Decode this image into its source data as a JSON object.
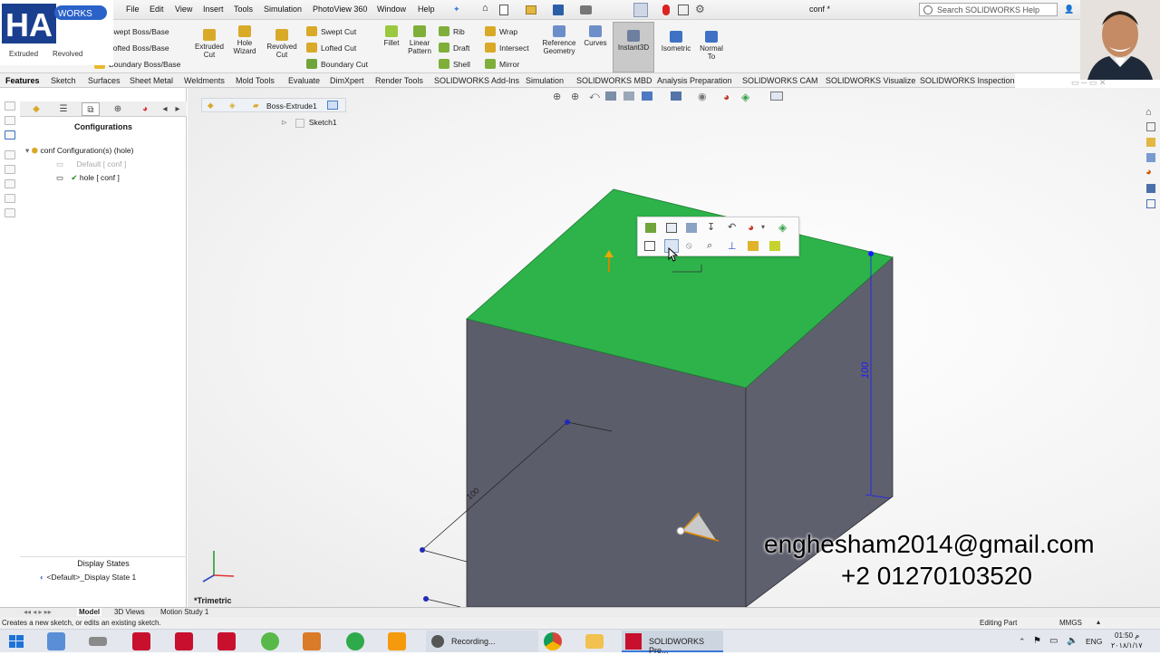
{
  "menu": {
    "items": [
      "File",
      "Edit",
      "View",
      "Insert",
      "Tools",
      "Simulation",
      "PhotoView 360",
      "Window",
      "Help"
    ],
    "doc_title": "conf *",
    "search_placeholder": "Search SOLIDWORKS Help"
  },
  "ribbon": {
    "extruded_boss": "Extruded Boss/Base",
    "revolved_boss": "Revolved Boss/Base",
    "swept_boss": "Swept Boss/Base",
    "lofted_boss": "Lofted Boss/Base",
    "boundary_boss": "Boundary Boss/Base",
    "extruded_cut": "Extruded Cut",
    "hole_wizard": "Hole Wizard",
    "revolved_cut": "Revolved Cut",
    "swept_cut": "Swept Cut",
    "lofted_cut": "Lofted Cut",
    "boundary_cut": "Boundary Cut",
    "fillet": "Fillet",
    "linear_pattern": "Linear Pattern",
    "rib": "Rib",
    "draft": "Draft",
    "shell": "Shell",
    "wrap": "Wrap",
    "intersect": "Intersect",
    "mirror": "Mirror",
    "reference_geometry": "Reference Geometry",
    "curves": "Curves",
    "instant3d": "Instant3D",
    "isometric": "Isometric",
    "normal_to": "Normal To"
  },
  "tabs": [
    "Features",
    "Sketch",
    "Surfaces",
    "Sheet Metal",
    "Weldments",
    "Mold Tools",
    "Evaluate",
    "DimXpert",
    "Render Tools",
    "SOLIDWORKS Add-Ins",
    "Simulation",
    "SOLIDWORKS MBD",
    "Analysis Preparation",
    "SOLIDWORKS CAM",
    "SOLIDWORKS Visualize",
    "SOLIDWORKS Inspection"
  ],
  "left_panel": {
    "title": "Configurations",
    "root": "conf Configuration(s)  (hole)",
    "items": [
      "Default [ conf ]",
      "hole [ conf ]"
    ],
    "display_states_title": "Display States",
    "display_state": "<Default>_Display State 1"
  },
  "breadcrumb": {
    "feature": "Boss-Extrude1",
    "sketch": "Sketch1"
  },
  "viewport": {
    "dimension_vertical": "100",
    "dimension_depth": "100",
    "view_name": "*Trimetric",
    "face_color": "#2db34a",
    "side_color": "#5c5d6b"
  },
  "bottom_tabs": [
    "Model",
    "3D Views",
    "Motion Study 1"
  ],
  "status": {
    "message": "Creates a new sketch, or edits an existing sketch.",
    "mode": "Editing Part",
    "units": "MMGS"
  },
  "taskbar": {
    "recording": "Recording...",
    "solidworks": "SOLIDWORKS Pre...",
    "lang": "ENG",
    "time": "01:50 م",
    "date": "٢٠١٨/١/١٧"
  },
  "contact": {
    "email": "enghesham2014@gmail.com",
    "phone": "+2 01270103520"
  }
}
